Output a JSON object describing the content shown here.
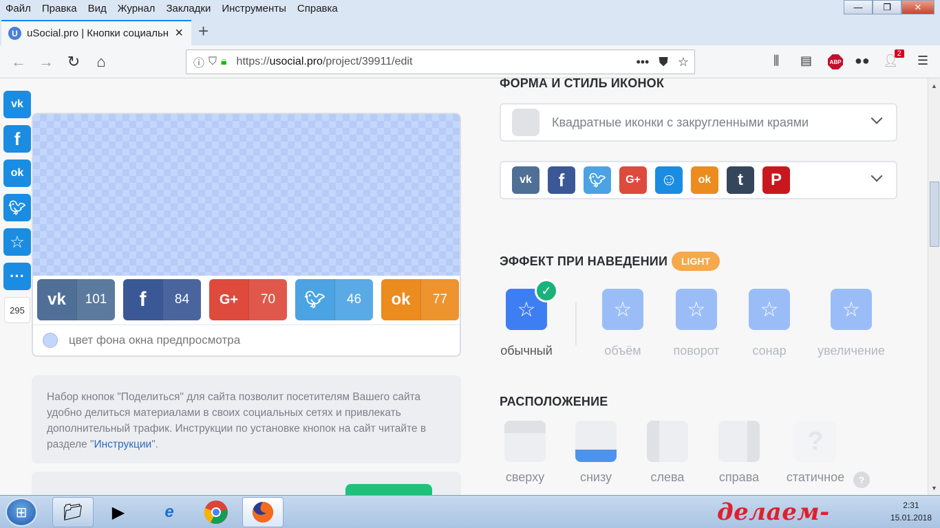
{
  "menubar": {
    "items": [
      "Файл",
      "Правка",
      "Вид",
      "Журнал",
      "Закладки",
      "Инструменты",
      "Справка"
    ]
  },
  "tab": {
    "title": "uSocial.pro | Кнопки социальн",
    "favicon_letter": "U"
  },
  "address": {
    "scheme": "https://",
    "host": "usocial.pro",
    "path": "/project/39911/edit"
  },
  "toolbar": {
    "notification_badge": "2",
    "abp_label": "ABP"
  },
  "sidebar": {
    "share_count": "295"
  },
  "preview": {
    "buttons": [
      {
        "network": "vk",
        "icon": "vk",
        "count": "101",
        "color": "#4f6f96"
      },
      {
        "network": "facebook",
        "icon": "f",
        "count": "84",
        "color": "#3b5896"
      },
      {
        "network": "google-plus",
        "icon": "G+",
        "count": "70",
        "color": "#de4a3c"
      },
      {
        "network": "twitter",
        "icon": "t",
        "count": "46",
        "color": "#4ba3e3"
      },
      {
        "network": "odnoklassniki",
        "icon": "ok",
        "count": "77",
        "color": "#ec8b1e"
      }
    ],
    "bg_color_label": "цвет фона окна предпросмотра"
  },
  "info": {
    "text_before": "Набор кнопок \"Поделиться\" для сайта позволит посетителям Вашего сайта удобно делиться материалами в своих социальных сетях и привлекать дополнительный трафик. Инструкции по установке кнопок на сайт читайте в разделе \"",
    "link": "Инструкции",
    "text_after": "\"."
  },
  "form_section": {
    "title": "ФОРМА И СТИЛЬ ИКОНОК",
    "selected_style": "Квадратные иконки с закругленными краями"
  },
  "networks": [
    {
      "name": "vk",
      "label": "vk",
      "color": "#4f6f96"
    },
    {
      "name": "facebook",
      "label": "f",
      "color": "#3b5896"
    },
    {
      "name": "twitter",
      "label": "t",
      "color": "#4ba3e3"
    },
    {
      "name": "google-plus",
      "label": "G+",
      "color": "#de4a3c"
    },
    {
      "name": "moimir",
      "label": "☺",
      "color": "#1a8de3"
    },
    {
      "name": "odnoklassniki",
      "label": "ok",
      "color": "#ec8b1e"
    },
    {
      "name": "tumblr",
      "label": "t",
      "color": "#35465c"
    },
    {
      "name": "pinterest",
      "label": "P",
      "color": "#c8181e"
    }
  ],
  "hover_section": {
    "title": "ЭФФЕКТ ПРИ НАВЕДЕНИИ",
    "badge": "LIGHT",
    "effects": [
      "обычный",
      "объём",
      "поворот",
      "сонар",
      "увеличение"
    ]
  },
  "position_section": {
    "title": "РАСПОЛОЖЕНИЕ",
    "options": [
      "сверху",
      "снизу",
      "слева",
      "справа",
      "статичное"
    ]
  },
  "watermark": "делаем-сайт.com",
  "clock": {
    "time": "2:31",
    "date": "15.01.2018"
  }
}
